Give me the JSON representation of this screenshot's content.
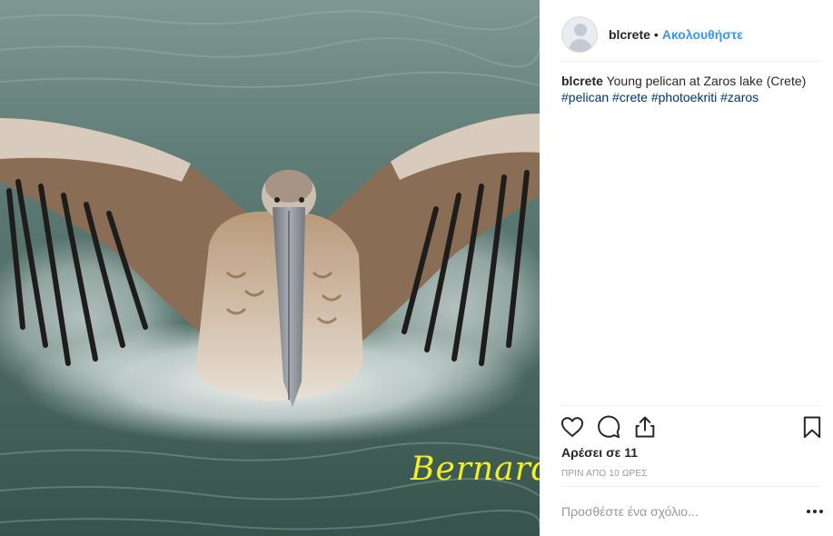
{
  "post": {
    "username": "blcrete",
    "separator": "•",
    "follow_label": "Ακολουθήστε",
    "caption": {
      "username": "blcrete",
      "text": "Young pelican at Zaros lake (Crete)",
      "hashtags": [
        "#pelican",
        "#crete",
        "#photoekriti",
        "#zaros"
      ]
    },
    "photo": {
      "watermark": "Bernard"
    },
    "actions": {
      "like_icon": "heart-icon",
      "comment_icon": "speech-bubble-icon",
      "share_icon": "share-icon",
      "save_icon": "bookmark-icon"
    },
    "likes_text": "Αρέσει σε 11",
    "time_ago": "ΠΡΙΝ ΑΠΟ 10 ΩΡΕΣ",
    "comment_placeholder": "Προσθέστε ένα σχόλιο...",
    "more_icon": "more-options-icon"
  },
  "colors": {
    "accent": "#3897f0",
    "hashtag": "#003569",
    "watermark": "#f3ee2a"
  }
}
